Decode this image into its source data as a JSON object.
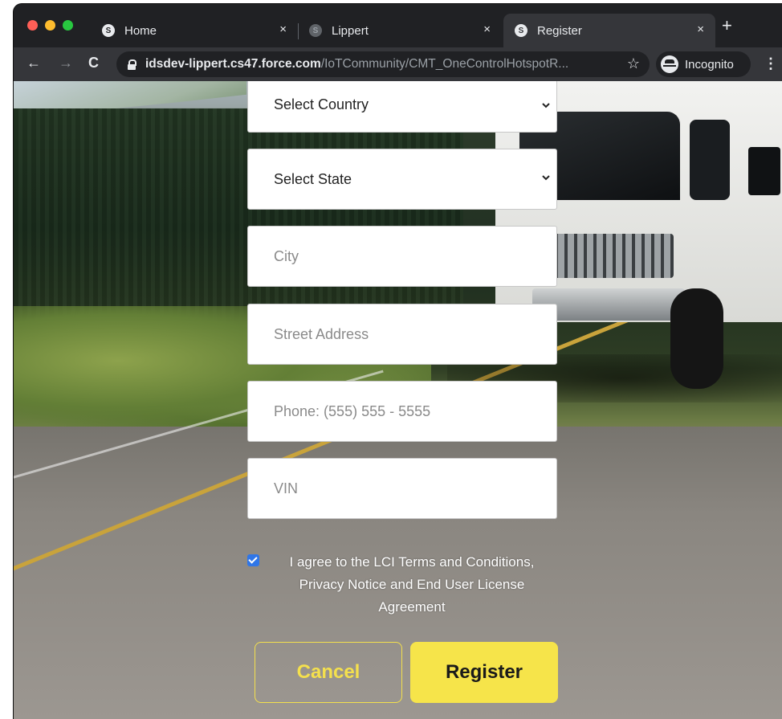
{
  "browser": {
    "tabs": [
      {
        "label": "Home"
      },
      {
        "label": "Lippert"
      },
      {
        "label": "Register",
        "active": true
      }
    ],
    "tab_close_glyph": "×",
    "new_tab_glyph": "+",
    "url_host": "idsdev-lippert.cs47.force.com",
    "url_path": "/IoTCommunity/CMT_OneControlHotspotR...",
    "profile_label": "Incognito",
    "icons": {
      "back": "←",
      "forward": "→",
      "reload": "C",
      "bookmark": "☆",
      "menu": "⋮"
    }
  },
  "form": {
    "country": {
      "value": "Select Country"
    },
    "state": {
      "value": "Select State"
    },
    "city": {
      "placeholder": "City"
    },
    "street": {
      "placeholder": "Street Address"
    },
    "phone": {
      "placeholder": "Phone: (555) 555 - 5555"
    },
    "vin": {
      "placeholder": "VIN"
    },
    "agree": {
      "checked": true,
      "text": "I agree to the LCI Terms and Conditions, Privacy Notice and End User License Agreement"
    },
    "cancel_label": "Cancel",
    "register_label": "Register"
  },
  "colors": {
    "accent_yellow": "#f6e44a",
    "checkbox_blue": "#2f76e8",
    "chrome_dark": "#202124",
    "chrome_toolbar": "#35363a"
  }
}
